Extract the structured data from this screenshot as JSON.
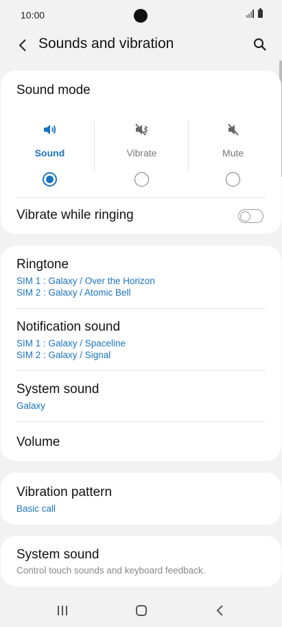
{
  "status_bar": {
    "time": "10:00"
  },
  "app_bar": {
    "title": "Sounds and vibration",
    "back_icon": "chevron-left-icon",
    "search_icon": "search-icon"
  },
  "sound_mode": {
    "title": "Sound mode",
    "options": [
      {
        "label": "Sound",
        "icon": "speaker-icon",
        "selected": true
      },
      {
        "label": "Vibrate",
        "icon": "vibrate-icon",
        "selected": false
      },
      {
        "label": "Mute",
        "icon": "mute-icon",
        "selected": false
      }
    ],
    "vibrate_while_ringing": {
      "label": "Vibrate while ringing",
      "on": false
    }
  },
  "tones": {
    "ringtone": {
      "label": "Ringtone",
      "sim1": "SIM 1 : Galaxy / Over the Horizon",
      "sim2": "SIM 2 : Galaxy / Atomic Bell"
    },
    "notification": {
      "label": "Notification sound",
      "sim1": "SIM 1 : Galaxy / Spaceline",
      "sim2": "SIM 2 : Galaxy / Signal"
    },
    "system": {
      "label": "System sound",
      "value": "Galaxy"
    },
    "volume": {
      "label": "Volume"
    }
  },
  "vibration_pattern": {
    "label": "Vibration pattern",
    "value": "Basic call"
  },
  "system_sound_control": {
    "label": "System sound",
    "description": "Control touch sounds and keyboard feedback."
  },
  "nav_bar": {
    "recents_icon": "recents-icon",
    "home_icon": "home-icon",
    "back_icon": "back-icon"
  },
  "colors": {
    "accent": "#1a73c0",
    "background": "#f2f2f2",
    "card": "#ffffff"
  }
}
